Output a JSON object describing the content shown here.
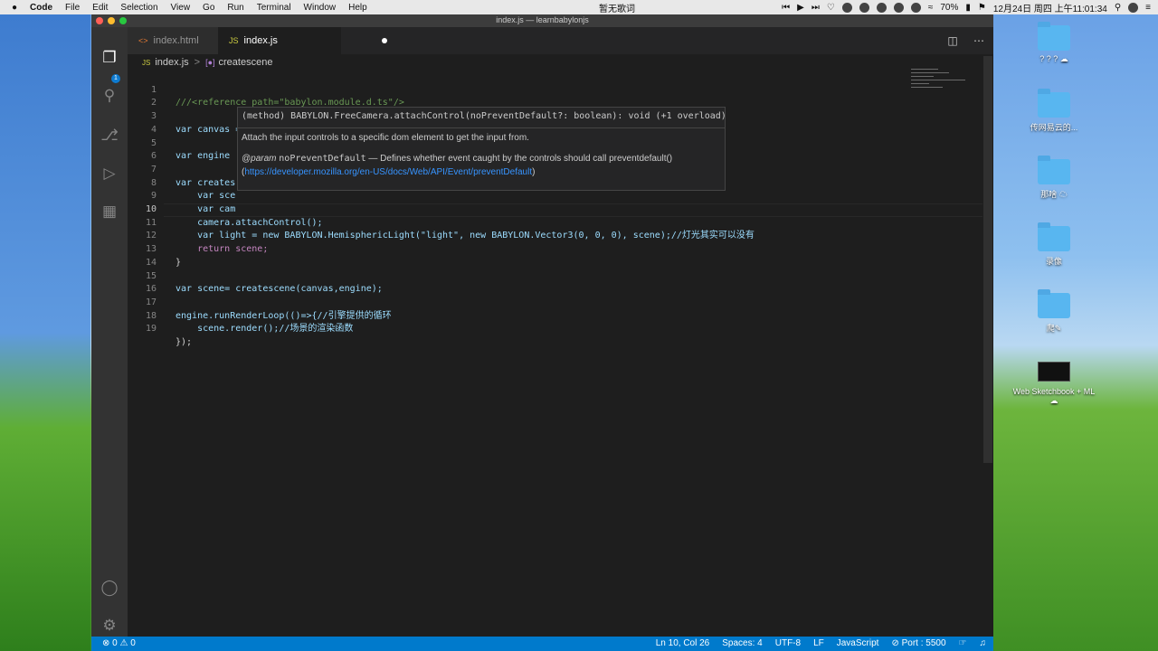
{
  "menubar": {
    "apple": "",
    "app": "Code",
    "items": [
      "File",
      "Edit",
      "Selection",
      "View",
      "Go",
      "Run",
      "Terminal",
      "Window",
      "Help"
    ],
    "center": "暂无歌词",
    "battery": "70%",
    "datetime": "12月24日 周四 上午11:01:34"
  },
  "window": {
    "title": "index.js — learnbabylonjs",
    "tabs": [
      {
        "label": "index.html"
      },
      {
        "label": "index.js"
      }
    ],
    "scm_badge": "1"
  },
  "breadcrumb": {
    "file": "index.js",
    "symbol": "createscene"
  },
  "editor": {
    "lines": [
      {
        "n": "1",
        "text": "///<reference path=\"babylon.module.d.ts\"/>"
      },
      {
        "n": "2",
        "text": ""
      },
      {
        "n": "3",
        "text": "var canvas = document.getElementById(\"mycanvas\");//获取canvas"
      },
      {
        "n": "4",
        "text": ""
      },
      {
        "n": "5",
        "text": "var engine"
      },
      {
        "n": "6",
        "text": ""
      },
      {
        "n": "7",
        "text": "var creates"
      },
      {
        "n": "8",
        "text": "    var sce"
      },
      {
        "n": "9",
        "text": "    var cam"
      },
      {
        "n": "10",
        "text": "    camera.attachControl();"
      },
      {
        "n": "11",
        "text": "    var light = new BABYLON.HemisphericLight(\"light\", new BABYLON.Vector3(0, 0, 0), scene);//灯光其实可以没有"
      },
      {
        "n": "12",
        "text": "    return scene;"
      },
      {
        "n": "13",
        "text": "}"
      },
      {
        "n": "14",
        "text": ""
      },
      {
        "n": "15",
        "text": "var scene= createscene(canvas,engine);"
      },
      {
        "n": "16",
        "text": ""
      },
      {
        "n": "17",
        "text": "engine.runRenderLoop(()=>{//引擎提供的循环"
      },
      {
        "n": "18",
        "text": "    scene.render();//场景的渲染函数"
      },
      {
        "n": "19",
        "text": "});"
      }
    ]
  },
  "hover": {
    "signature": "(method) BABYLON.FreeCamera.attachControl(noPreventDefault?: boolean): void (+1 overload)",
    "description": "Attach the input controls to a specific dom element to get the input from.",
    "param_tag": "@param",
    "param_name": "noPreventDefault",
    "param_desc": " — Defines whether event caught by the controls should call preventdefault() (",
    "link": "https://developer.mozilla.org/en-US/docs/Web/API/Event/preventDefault",
    "close": ")"
  },
  "status": {
    "errors": "0",
    "warnings": "0",
    "position": "Ln 10, Col 26",
    "spaces": "Spaces: 4",
    "encoding": "UTF-8",
    "eol": "LF",
    "language": "JavaScript",
    "port": "Port : 5500"
  },
  "desktop": {
    "items": [
      {
        "label": "? ? ? ☁"
      },
      {
        "label": "传网易云的..."
      },
      {
        "label": "那啥 ☁"
      },
      {
        "label": "录像"
      },
      {
        "label": "爬✎"
      },
      {
        "label": "Web Sketchbook + ML ☁"
      }
    ]
  }
}
